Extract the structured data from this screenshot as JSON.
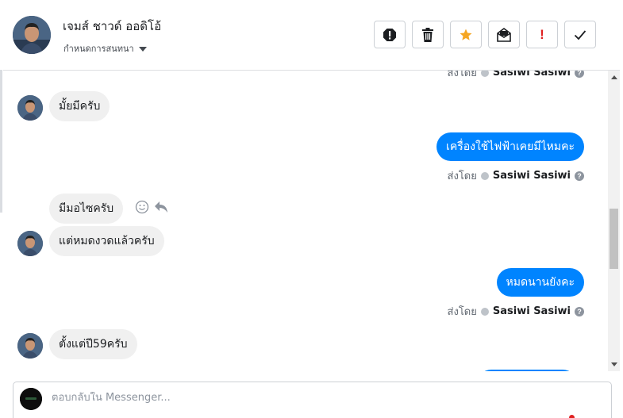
{
  "header": {
    "contact_name": "เจมส์ ชาวด์ ออดิโอ้",
    "assign_label": "กำหนดการสนทนา"
  },
  "actions": [
    {
      "name": "report-button",
      "icon": "exclamation-circle-icon"
    },
    {
      "name": "delete-button",
      "icon": "trash-icon"
    },
    {
      "name": "star-button",
      "icon": "star-icon",
      "color": "#f5a623"
    },
    {
      "name": "mark-unread-button",
      "icon": "envelope-icon"
    },
    {
      "name": "spam-button",
      "icon": "exclamation-icon",
      "label": "!",
      "color": "#e02020"
    },
    {
      "name": "done-button",
      "icon": "checkmark-icon"
    }
  ],
  "messages": {
    "top_meta": {
      "prefix": "ส่งโดย",
      "sender": "Sasiwi Sasiwi"
    },
    "m1": "มั้ยมีครับ",
    "m2": "เครื่องใช้ไฟฟ้าเคยมีไหมคะ",
    "m2_meta": {
      "prefix": "ส่งโดย",
      "sender": "Sasiwi Sasiwi"
    },
    "m3": "มีมอไซครับ",
    "m4": "แต่หมดงวดแล้วครับ",
    "m5": "หมดนานยังคะ",
    "m5_meta": {
      "prefix": "ส่งโดย",
      "sender": "Sasiwi Sasiwi"
    },
    "m6": "ตั้งแต่ปี59ครับ"
  },
  "composer": {
    "placeholder": "ตอบกลับใน Messenger..."
  },
  "colors": {
    "outgoing": "#0084ff",
    "incoming": "#f0f0f0",
    "star": "#f5a623",
    "alert": "#e02020"
  }
}
